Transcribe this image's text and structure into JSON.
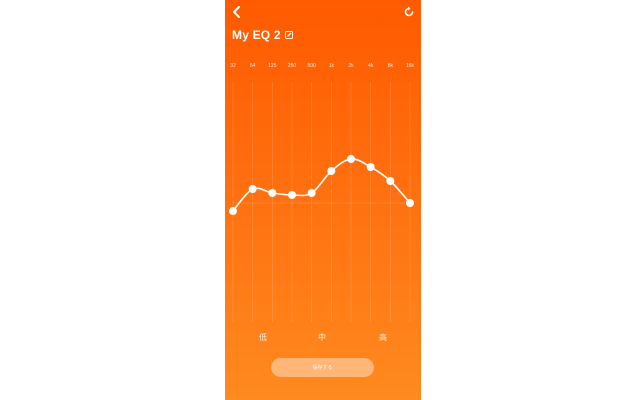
{
  "header": {
    "title": "My EQ 2",
    "back_icon": "chevron-left-icon",
    "reset_icon": "reset-icon",
    "edit_icon": "edit-icon"
  },
  "eq": {
    "frequencies": [
      "32",
      "64",
      "125",
      "250",
      "500",
      "1k",
      "2k",
      "4k",
      "8k",
      "16k"
    ],
    "gains": [
      -0.4,
      0.7,
      0.5,
      0.4,
      0.5,
      1.6,
      2.2,
      1.8,
      1.1,
      0.0
    ]
  },
  "bands": {
    "low": "低",
    "mid": "中",
    "high": "高"
  },
  "save_label": "保存する",
  "colors": {
    "gradient_top": "#ff5a00",
    "gradient_bottom": "#ff8a1f",
    "accent": "#ffffff"
  }
}
